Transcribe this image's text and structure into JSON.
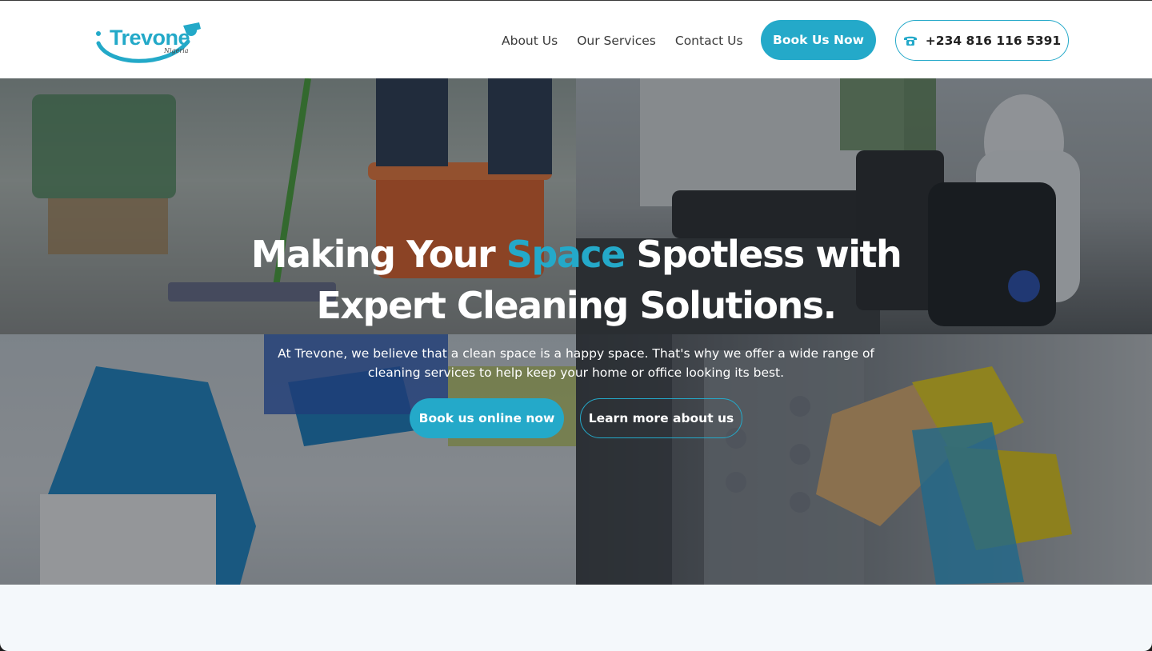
{
  "brand": {
    "name": "Trevone",
    "region": "Nigeria",
    "accent_color": "#24a9c9"
  },
  "nav": {
    "items": [
      {
        "label": "About Us"
      },
      {
        "label": "Our Services"
      },
      {
        "label": "Contact Us"
      }
    ],
    "book_label": "Book Us Now",
    "phone_label": "+234 816 116 5391",
    "phone_icon": "phone-icon"
  },
  "hero": {
    "title_prefix": "Making Your ",
    "title_accent": "Space",
    "title_suffix": " Spotless with",
    "title_line2": "Expert Cleaning Solutions.",
    "description": "At Trevone, we believe that a clean space is a happy space. That's why we offer a wide range of cleaning services to help keep your home or office looking its best.",
    "primary_cta": "Book us online now",
    "secondary_cta": "Learn more about us"
  }
}
